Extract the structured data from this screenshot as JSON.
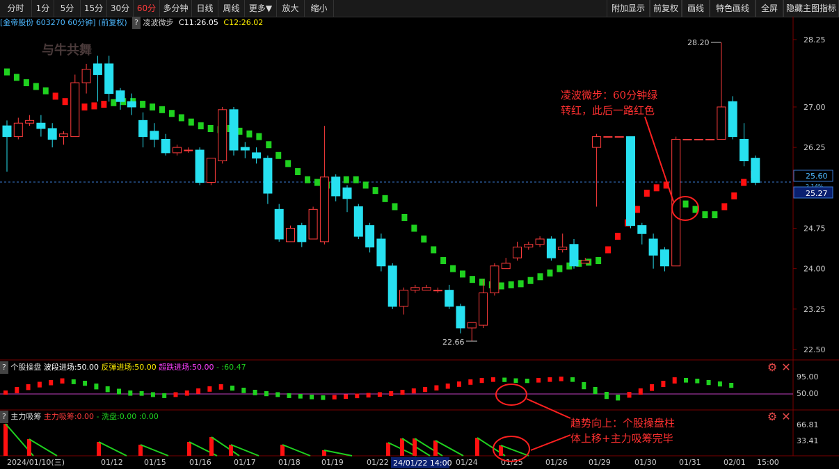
{
  "toolbar": {
    "left": [
      "分时",
      "1分",
      "5分",
      "15分",
      "30分",
      "60分",
      "多分钟",
      "日线",
      "周线",
      "更多▼",
      "放大",
      "缩小"
    ],
    "active_index": 5,
    "right": [
      "附加显示",
      "前复权",
      "画线",
      "特色画线",
      "全屏",
      "隐藏主图指标"
    ]
  },
  "info": {
    "stock": "[金帝股份 603270 60分钟]",
    "adjust": "(前复权)",
    "indicator": "凌波微步",
    "c1": "C11:26.05",
    "c2": "C12:26.02"
  },
  "watermark": "与牛共舞",
  "price_axis": {
    "ticks": [
      "28.25",
      "27.00",
      "26.25",
      "24.75",
      "24.00",
      "23.25",
      "22.50"
    ],
    "current": "25.60",
    "current_pct": "2.14%",
    "cursor": "25.27"
  },
  "annotations": {
    "high": "28.20",
    "low": "22.66",
    "note1": [
      "凌波微步：60分钟绿",
      "转红，此后一路红色"
    ],
    "note2": [
      "趋势向上：个股操盘柱",
      "体上移+主力吸筹完毕"
    ]
  },
  "panel1": {
    "title": "个股操盘",
    "l1": "波段进场:50.00",
    "l2": "反弹进场:50.00",
    "l3": "超跌进场:50.00",
    "l4": "- :60.47",
    "ticks": [
      "95.00",
      "50.00"
    ]
  },
  "panel2": {
    "title": "主力吸筹",
    "l1": "主力吸筹:0.00",
    "l2": "- 洗盘:0.00",
    "l3": ":0.00",
    "ticks": [
      "66.81",
      "33.41"
    ]
  },
  "x_axis": {
    "labels": [
      "2024/01/10(三)",
      "01/12",
      "01/15",
      "01/16",
      "01/17",
      "01/18",
      "01/19",
      "01/22",
      "01/24",
      "01/25",
      "01/26",
      "01/29",
      "01/30",
      "01/31",
      "02/01",
      "15:00"
    ],
    "highlight": "24/01/22 14:00"
  },
  "colors": {
    "up": "#ff3c3c",
    "down": "#27e0f0",
    "green": "#1fd11f",
    "red": "#ff1010",
    "purple": "#c040c0",
    "grid": "#7a0000"
  },
  "chart_data": {
    "type": "candlestick",
    "period": "60分钟",
    "columns": [
      "open",
      "close",
      "high",
      "low"
    ],
    "candles": [
      [
        26.65,
        26.45,
        26.75,
        25.8
      ],
      [
        26.45,
        26.7,
        26.8,
        26.4
      ],
      [
        26.7,
        26.75,
        26.85,
        26.65
      ],
      [
        26.7,
        26.6,
        26.85,
        26.45
      ],
      [
        26.6,
        26.4,
        26.7,
        26.25
      ],
      [
        26.45,
        26.5,
        26.55,
        26.3
      ],
      [
        26.45,
        27.45,
        27.6,
        26.45
      ],
      [
        27.45,
        27.7,
        27.8,
        27.25
      ],
      [
        27.8,
        27.6,
        27.95,
        27.1
      ],
      [
        27.8,
        27.25,
        27.95,
        27.1
      ],
      [
        27.3,
        27.1,
        27.35,
        26.95
      ],
      [
        27.1,
        27.0,
        27.25,
        26.85
      ],
      [
        26.75,
        26.45,
        26.9,
        26.25
      ],
      [
        26.55,
        26.4,
        26.7,
        26.25
      ],
      [
        26.4,
        26.15,
        26.5,
        26.1
      ],
      [
        26.15,
        26.25,
        26.3,
        26.1
      ],
      [
        26.2,
        26.2,
        26.25,
        26.15
      ],
      [
        26.2,
        25.6,
        26.25,
        25.55
      ],
      [
        25.6,
        26.05,
        26.05,
        25.55
      ],
      [
        26.0,
        26.95,
        27.0,
        25.95
      ],
      [
        26.95,
        26.2,
        27.0,
        26.1
      ],
      [
        26.25,
        26.2,
        26.35,
        26.05
      ],
      [
        26.15,
        26.05,
        26.25,
        25.95
      ],
      [
        26.05,
        25.4,
        26.1,
        25.2
      ],
      [
        25.1,
        24.55,
        25.2,
        24.5
      ],
      [
        24.5,
        24.75,
        24.8,
        24.6
      ],
      [
        24.8,
        24.5,
        24.85,
        24.4
      ],
      [
        24.55,
        25.1,
        25.15,
        24.55
      ],
      [
        24.5,
        25.7,
        26.65,
        24.45
      ],
      [
        25.7,
        25.35,
        25.75,
        25.25
      ],
      [
        25.5,
        25.3,
        25.55,
        25.05
      ],
      [
        25.15,
        24.6,
        25.2,
        24.55
      ],
      [
        24.8,
        24.4,
        24.85,
        24.3
      ],
      [
        24.55,
        24.05,
        24.65,
        23.95
      ],
      [
        24.05,
        23.3,
        24.1,
        23.25
      ],
      [
        23.3,
        23.6,
        23.65,
        23.15
      ],
      [
        23.6,
        23.65,
        23.7,
        23.55
      ],
      [
        23.6,
        23.65,
        23.7,
        23.6
      ],
      [
        23.6,
        23.6,
        23.65,
        23.55
      ],
      [
        23.6,
        23.3,
        23.7,
        23.25
      ],
      [
        23.3,
        22.9,
        23.35,
        22.8
      ],
      [
        22.9,
        23.0,
        23.0,
        22.66
      ],
      [
        22.95,
        23.55,
        23.8,
        22.9
      ],
      [
        23.55,
        24.05,
        24.1,
        23.5
      ],
      [
        24.0,
        24.1,
        24.2,
        24.0
      ],
      [
        24.2,
        24.4,
        24.5,
        24.15
      ],
      [
        24.4,
        24.45,
        24.5,
        24.35
      ],
      [
        24.45,
        24.55,
        24.6,
        24.4
      ],
      [
        24.55,
        24.2,
        24.6,
        24.15
      ],
      [
        24.35,
        24.4,
        24.65,
        24.3
      ],
      [
        24.45,
        24.05,
        24.55,
        24.0
      ],
      [
        24.1,
        24.15,
        24.2,
        24.1
      ],
      [
        26.25,
        26.45,
        26.5,
        25.15
      ],
      [
        26.45,
        26.45,
        26.45,
        26.45
      ],
      [
        26.45,
        26.45,
        26.45,
        26.45
      ],
      [
        26.45,
        24.8,
        26.45,
        24.75
      ],
      [
        24.8,
        24.65,
        24.85,
        24.45
      ],
      [
        24.55,
        24.25,
        24.65,
        24.0
      ],
      [
        24.35,
        24.05,
        24.4,
        23.95
      ],
      [
        24.05,
        26.4,
        26.45,
        24.05
      ],
      [
        26.4,
        26.4,
        26.4,
        26.4
      ],
      [
        26.4,
        26.4,
        26.4,
        26.4
      ],
      [
        26.4,
        26.4,
        26.4,
        26.4
      ],
      [
        26.4,
        27.0,
        28.2,
        26.4
      ],
      [
        27.1,
        26.45,
        27.2,
        26.4
      ],
      [
        26.4,
        26.0,
        26.7,
        25.9
      ],
      [
        26.05,
        25.6,
        26.1,
        25.55
      ]
    ]
  }
}
